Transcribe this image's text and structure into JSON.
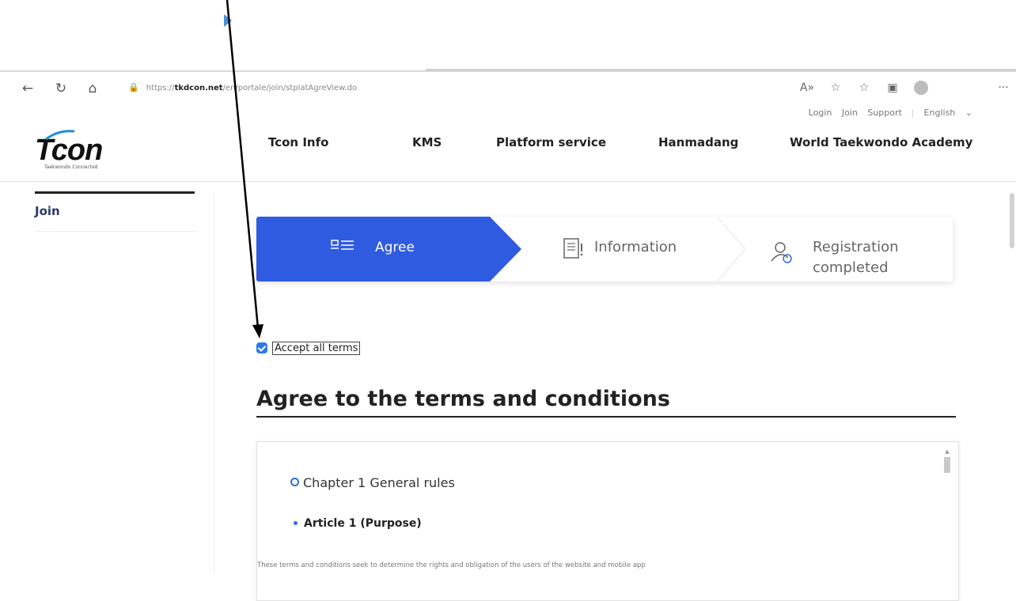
{
  "browser": {
    "url_prefix": "https://",
    "url_host": "tkdcon.net",
    "url_path": "/en/portale/join/stplatAgreView.do"
  },
  "utility_links": [
    "Login",
    "Join",
    "Support",
    "English"
  ],
  "logo": {
    "name": "Tcon",
    "tagline": "Taekwondo Connected"
  },
  "gnb": [
    "Tcon Info",
    "KMS",
    "Platform service",
    "Hanmadang",
    "World Taekwondo Academy"
  ],
  "sidebar": {
    "item": "Join"
  },
  "steps": [
    {
      "label": "Agree",
      "active": true
    },
    {
      "label": "Information",
      "active": false
    },
    {
      "label": "Registration completed",
      "active": false
    }
  ],
  "accept_all": {
    "label": "Accept all terms",
    "checked": true
  },
  "title": "Agree to the terms and conditions",
  "terms": {
    "chapter": "Chapter 1 General rules",
    "article": "Article 1 (Purpose)",
    "text": "These terms and conditions seek to determine the rights and obligation of the users of the website and mobile app"
  },
  "colors": {
    "primary": "#2f5be0",
    "checkbox": "#2c7be5",
    "annotation_arrow": "#000000",
    "arrow_tip": "#4a90d9"
  }
}
